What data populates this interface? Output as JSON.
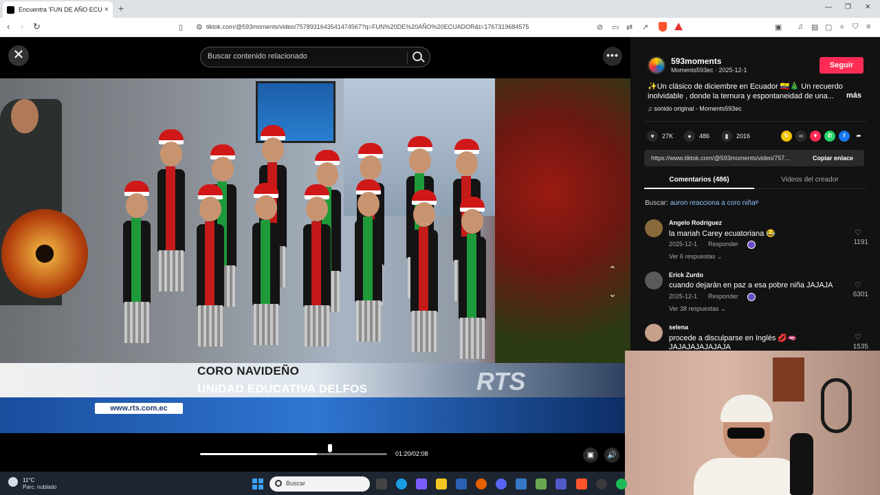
{
  "browser": {
    "tab_title": "Encuentra 'FUN DE AÑO ECU",
    "tab_close": "×",
    "new_tab": "+",
    "url": "tiktok.com/@593moments/video/7578931643541474567?q=FUN%20DE%20AÑO%20ECUADOR&t=1767319684575",
    "minimize": "—",
    "maximize": "❐",
    "close": "✕"
  },
  "player": {
    "search_placeholder": "Buscar contenido relacionado",
    "close_glyph": "✕",
    "more_glyph": "•••",
    "caption_line1": "CORO NAVIDEÑO",
    "caption_line2": "UNIDAD EDUCATIVA DELFOS",
    "site_badge": "www.rts.com.ec",
    "watermark": "RTS",
    "time": "01:20/02:08",
    "progress": 0.625
  },
  "creator": {
    "username": "593moments",
    "meta": "Moments593ec · 2025-12-1",
    "follow_label": "Seguir",
    "description": "✨Un clásico de diciembre en Ecuador 🇪🇨🎄 Un recuerdo inolvidable , donde la ternura y espontaneidad de una...",
    "more_label": "más",
    "sound": "♫ sonido original - Moments593ec"
  },
  "stats": {
    "likes": "27K",
    "comments": "486",
    "saves": "2016"
  },
  "share": {
    "link": "https://www.tiktok.com/@593moments/video/757...",
    "copy_label": "Copiar enlace"
  },
  "tabs": {
    "comments": "Comentarios (486)",
    "creator_videos": "Videos del creador"
  },
  "search_suggestion": {
    "prefix": "Buscar:",
    "query": "auron reacciona a coro niña"
  },
  "comments": [
    {
      "user": "Angelo Rodríguez",
      "text": "la mariah Carey ecuatoriana 😂",
      "date": "2025-12-1",
      "reply": "Responder",
      "replies": "Ver 6 respuestas ⌄",
      "likes": "1191",
      "avatar_color": "#8a6a3c"
    },
    {
      "user": "Erick Zurdo",
      "text": "cuando dejarán en paz a esa pobre niña JAJAJA",
      "date": "2025-12-1",
      "reply": "Responder",
      "replies": "Ver 38 respuestas ⌄",
      "likes": "6301",
      "avatar_color": "#5a5a5a"
    },
    {
      "user": "selena",
      "text": "procede a disculparse en Inglés 💋🫦",
      "text2": "JAJAJAJAJAJAJA",
      "likes": "1535",
      "avatar_color": "#c7a08c"
    }
  ],
  "taskbar": {
    "temp": "11°C",
    "condition": "Parc. nublado",
    "search_label": "Buscar"
  }
}
